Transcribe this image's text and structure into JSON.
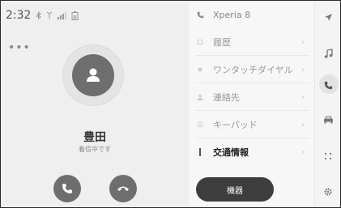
{
  "status_bar": {
    "time": "2:32",
    "icons": [
      "bluetooth-icon",
      "signal-strength-icon",
      "signal-bars-icon",
      "battery-icon"
    ]
  },
  "call": {
    "contact_name": "豊田",
    "status_text": "着信中です",
    "buttons": {
      "answer": "phone-answer-icon",
      "hangup": "phone-hangup-icon"
    }
  },
  "phone_menu": {
    "device_name": "Xperia 8",
    "items": [
      {
        "label": "履歴",
        "icon": "history-icon",
        "enabled": false
      },
      {
        "label": "ワンタッチダイヤル",
        "icon": "one-touch-dial-icon",
        "enabled": false
      },
      {
        "label": "連絡先",
        "icon": "contacts-icon",
        "enabled": false
      },
      {
        "label": "キーパッド",
        "icon": "keypad-icon",
        "enabled": false
      },
      {
        "label": "交通情報",
        "icon": "traffic-info-icon",
        "enabled": true
      }
    ],
    "device_button": "機器"
  },
  "side_rail": {
    "items": [
      "navigation-icon",
      "music-icon",
      "phone-icon",
      "car-icon",
      "apps-icon",
      "settings-icon"
    ],
    "active": "phone-icon"
  },
  "colors": {
    "button_dark": "#6e6e6e",
    "device_button": "#3d3d3d",
    "active_rail": "#e2e2e2"
  }
}
